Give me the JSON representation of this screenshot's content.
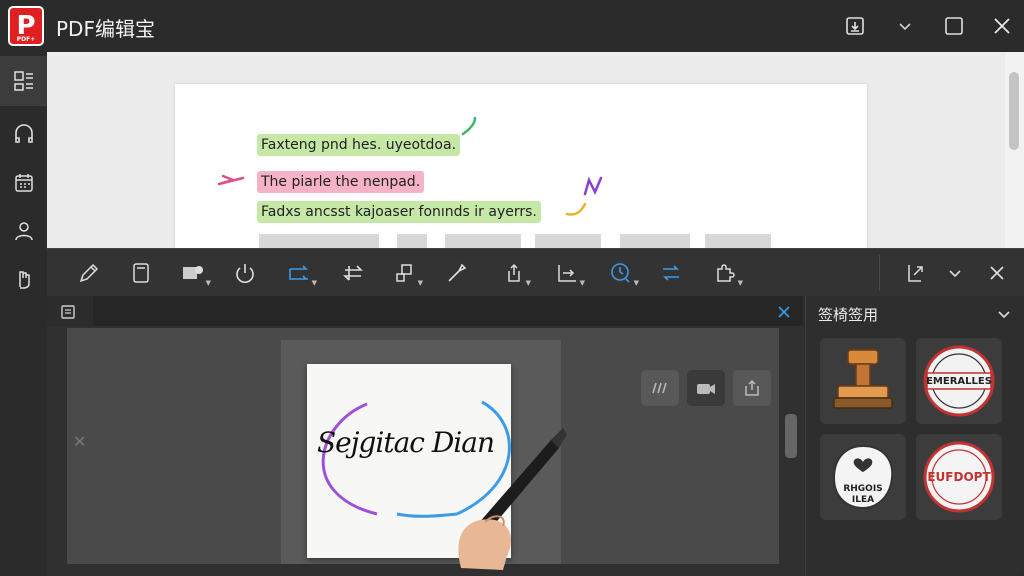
{
  "app": {
    "title": "PDF编辑宝",
    "logo_letter": "P",
    "logo_caption": "PDF+"
  },
  "document": {
    "lines": [
      {
        "text": "Faxteng pnd hes. uyeotdoa.",
        "color": "green"
      },
      {
        "text": "The piarle the nenpad.",
        "color": "pink"
      },
      {
        "text": "Fadxs ancsst kajoaser fonınds ir ayerrs.",
        "color": "green"
      }
    ]
  },
  "signature": {
    "text": "Sejgitac Dian"
  },
  "stamps_panel": {
    "title": "签椅签用",
    "stamps": [
      {
        "name": "wooden-stamp"
      },
      {
        "name": "round-seal-1",
        "text": "EMERALLES"
      },
      {
        "name": "heart-seal",
        "text": "RHGOIS ILEA"
      },
      {
        "name": "round-seal-2",
        "text": "EUFDOPT"
      }
    ]
  },
  "colors": {
    "accent_blue": "#3a9be8",
    "highlight_green": "#c6e8a6",
    "highlight_pink": "#f6b3c8",
    "logo_red": "#e02020"
  }
}
